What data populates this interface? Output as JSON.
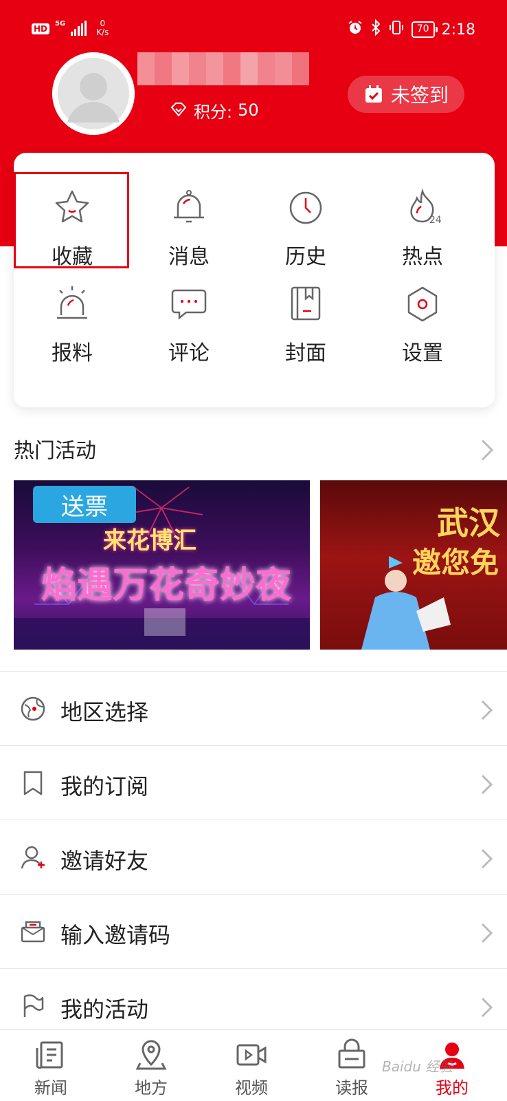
{
  "status_bar": {
    "hd": "HD",
    "network": "5G",
    "speed_value": "0",
    "speed_unit": "K/s",
    "battery": "70",
    "time": "2:18"
  },
  "profile": {
    "points_label": "积分:",
    "points_value": "50",
    "signin_label": "未签到"
  },
  "menu_grid": [
    {
      "label": "收藏",
      "icon": "star-icon"
    },
    {
      "label": "消息",
      "icon": "bell-icon"
    },
    {
      "label": "历史",
      "icon": "clock-icon"
    },
    {
      "label": "热点",
      "icon": "fire-24-icon"
    },
    {
      "label": "报料",
      "icon": "alarm-light-icon"
    },
    {
      "label": "评论",
      "icon": "comment-icon"
    },
    {
      "label": "封面",
      "icon": "bookmark-card-icon"
    },
    {
      "label": "设置",
      "icon": "hexagon-gear-icon"
    }
  ],
  "hot_activities": {
    "title": "热门活动",
    "banner1": {
      "tag": "送票",
      "line1": "来花博汇",
      "line2": "焰遇万花奇妙夜"
    },
    "banner2": {
      "line1": "武汉",
      "line2": "邀您免"
    }
  },
  "list": [
    {
      "label": "地区选择",
      "icon": "location-globe-icon"
    },
    {
      "label": "我的订阅",
      "icon": "bookmark-icon"
    },
    {
      "label": "邀请好友",
      "icon": "add-user-icon"
    },
    {
      "label": "输入邀请码",
      "icon": "code-envelope-icon"
    },
    {
      "label": "我的活动",
      "icon": "flag-icon"
    }
  ],
  "tabbar": [
    {
      "label": "新闻",
      "icon": "news-icon"
    },
    {
      "label": "地方",
      "icon": "map-pin-icon"
    },
    {
      "label": "视频",
      "icon": "video-icon"
    },
    {
      "label": "读报",
      "icon": "newspaper-icon"
    },
    {
      "label": "我的",
      "icon": "profile-icon",
      "active": true
    }
  ],
  "watermark": "Baidu 经验",
  "colors": {
    "brand_red": "#e60012",
    "text": "#222222",
    "divider": "#e6e6e6"
  }
}
